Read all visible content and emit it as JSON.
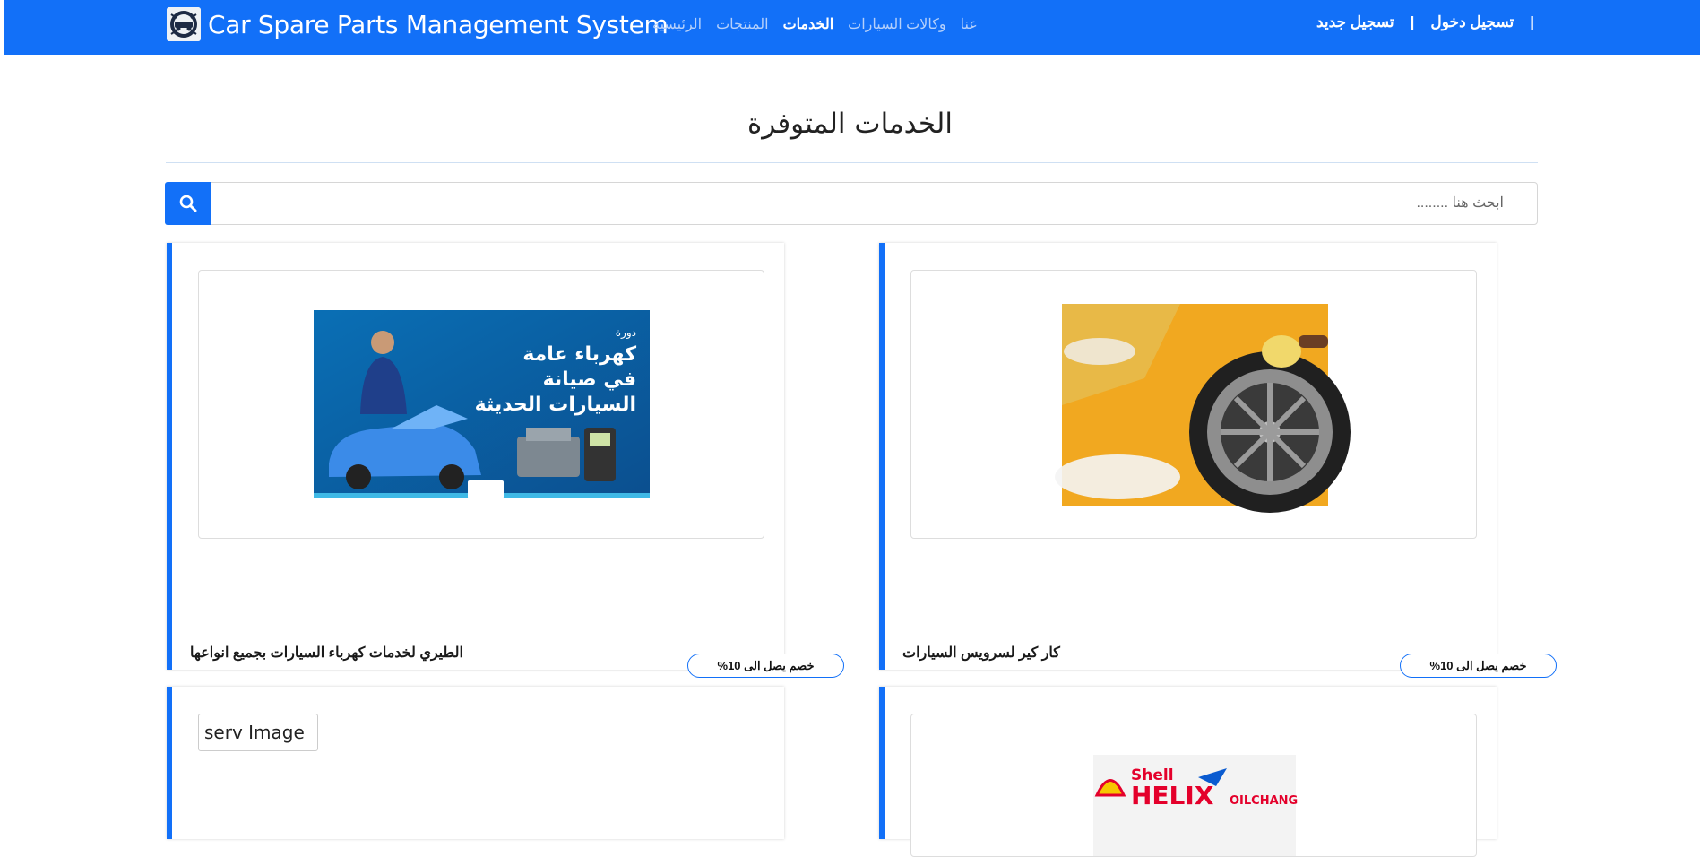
{
  "brand": {
    "title": "Car Spare Parts Management System"
  },
  "nav": {
    "links": [
      {
        "label": "الرئيسية",
        "active": false
      },
      {
        "label": "المنتجات",
        "active": false
      },
      {
        "label": "الخدمات",
        "active": true
      },
      {
        "label": "وكالات السيارات",
        "active": false
      },
      {
        "label": "عنا",
        "active": false
      }
    ]
  },
  "auth": {
    "login": "تسجيل دخول",
    "register": "تسجيل جديد",
    "separator": "|"
  },
  "page": {
    "heading": "الخدمات المتوفرة"
  },
  "search": {
    "placeholder": "ابحث هنا ........"
  },
  "services": [
    {
      "title": "الطيري لخدمات كهرباء السيارات بجميع انواعها",
      "discount": "خصم يصل الى 10%",
      "image_text": [
        "كهرباء عامة",
        "في صيانة",
        "السيارات الحديثة"
      ],
      "image_badge": "دورة"
    },
    {
      "title": "كار كير لسرويس السيارات",
      "discount": "خصم يصل الى 10%"
    },
    {
      "image_alt": "serv Image"
    },
    {
      "image_text": [
        "Shell",
        "HELIX",
        "OILCHANG"
      ]
    }
  ],
  "colors": {
    "primary": "#1270f8",
    "nav_inactive": "#b5d0fb"
  }
}
